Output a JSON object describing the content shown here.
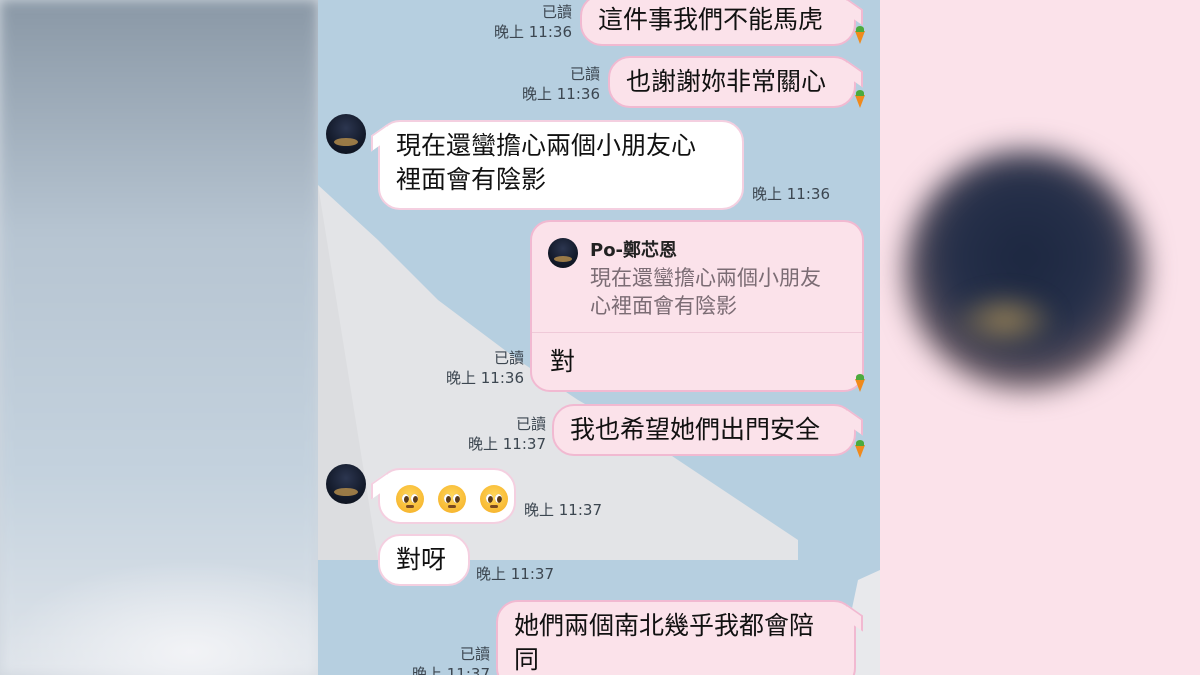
{
  "chat": {
    "messages": [
      {
        "id": "m1",
        "direction": "out",
        "text": "這件事我們不能馬虎",
        "read_label": "已讀",
        "time": "晚上 11:36"
      },
      {
        "id": "m2",
        "direction": "out",
        "text": "也謝謝妳非常關心",
        "read_label": "已讀",
        "time": "晚上 11:36"
      },
      {
        "id": "m3",
        "direction": "in",
        "lines": [
          "現在還蠻擔心兩個小朋友心",
          "裡面會有陰影"
        ],
        "time": "晚上 11:36"
      },
      {
        "id": "m4",
        "direction": "out",
        "quoted_sender": "Po-鄭芯恩",
        "quoted_lines": [
          "現在還蠻擔心兩個小朋友",
          "心裡面會有陰影"
        ],
        "text": "對",
        "read_label": "已讀",
        "time": "晚上 11:36"
      },
      {
        "id": "m5",
        "direction": "out",
        "text": "我也希望她們出門安全",
        "read_label": "已讀",
        "time": "晚上 11:37"
      },
      {
        "id": "m6",
        "direction": "in",
        "emoji_count": 3,
        "emoji_name": "pleading-face",
        "time": "晚上 11:37"
      },
      {
        "id": "m7",
        "direction": "in",
        "text": "對呀",
        "time": "晚上 11:37"
      },
      {
        "id": "m8",
        "direction": "out",
        "lines": [
          "她們兩個南北幾乎我都會陪",
          "同"
        ],
        "read_label": "已讀",
        "time": "晚上 11:37"
      }
    ]
  },
  "colors": {
    "chat_background": "#b6cfe0",
    "outgoing_bubble": "#fbe2ea",
    "incoming_bubble": "#ffffff",
    "bubble_border": "#f1b9d1",
    "sticker_accent": "#f08a1c"
  },
  "icons": [
    "carrot-icon",
    "avatar",
    "pleading-face-emoji"
  ]
}
